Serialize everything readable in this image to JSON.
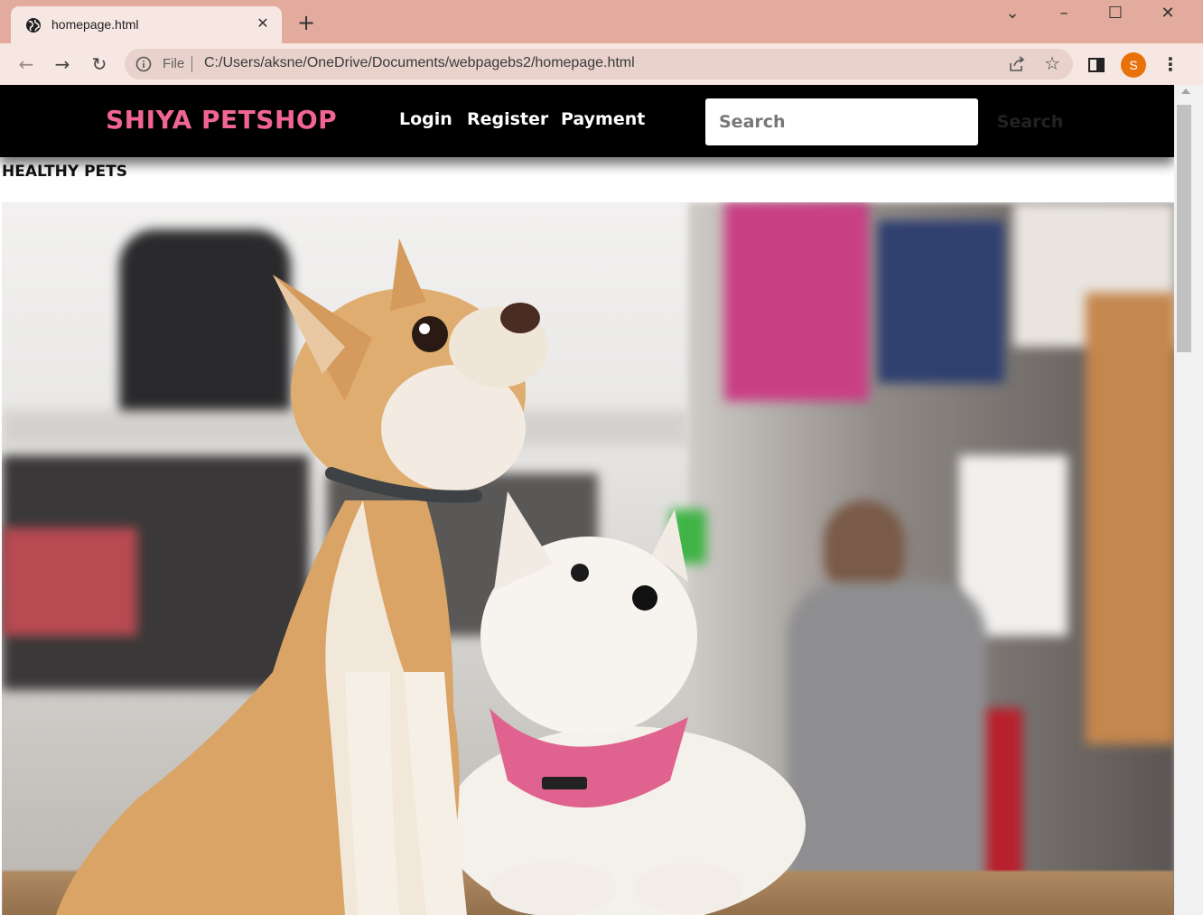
{
  "browser": {
    "tab_title": "homepage.html",
    "new_tab": "+",
    "url_scheme": "File",
    "url": "C:/Users/aksne/OneDrive/Documents/webpagebs2/homepage.html",
    "profile_initial": "S",
    "accent": "#e8710a",
    "frame_color": "#e2ab9d"
  },
  "site": {
    "brand": "SHIYA PETSHOP",
    "brand_color": "#f06595",
    "nav": {
      "login": "Login",
      "register": "Register",
      "payment": "Payment"
    },
    "search": {
      "placeholder": "Search",
      "button_label": "Search"
    },
    "tagline": "HEALTHY PETS",
    "hero": {
      "subject": "A chihuahua and a West Highland terrier in a pink harness sitting in a pet shop"
    }
  }
}
